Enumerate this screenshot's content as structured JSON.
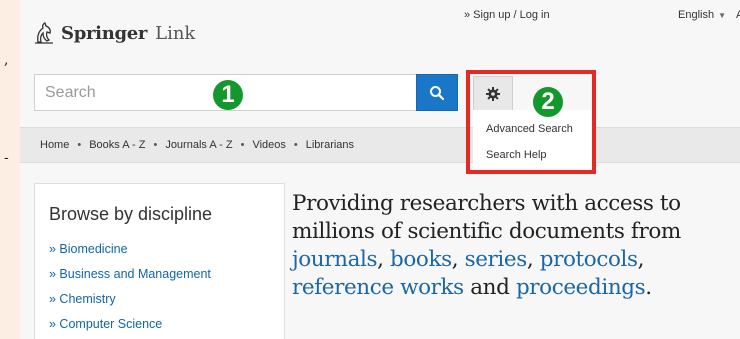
{
  "edge_marks": [
    ",",
    "-"
  ],
  "header": {
    "logo_primary": "Springer",
    "logo_secondary": "Link",
    "signup_label": "» Sign up / Log in",
    "language_label": "English",
    "language_extra": "A"
  },
  "search": {
    "placeholder": "Search",
    "search_icon": "magnifier-icon",
    "settings_icon": "gear-icon"
  },
  "nav": {
    "items": [
      "Home",
      "Books A - Z",
      "Journals A - Z",
      "Videos",
      "Librarians"
    ],
    "separator": "•"
  },
  "search_menu": {
    "items": [
      "Advanced Search",
      "Search Help"
    ]
  },
  "badges": [
    "1",
    "2"
  ],
  "browse": {
    "title": "Browse by discipline",
    "items": [
      "» Biomedicine",
      "» Business and Management",
      "» Chemistry",
      "» Computer Science"
    ]
  },
  "tagline": {
    "line1": "Providing researchers with access to",
    "line2": "millions of scientific documents from",
    "links": [
      "journals",
      "books",
      "series",
      "protocols",
      "reference works",
      "proceedings"
    ],
    "and_word": "and",
    "comma": ",",
    "period": "."
  },
  "colors": {
    "accent_blue": "#1a77c8",
    "highlight_red": "#e42a23",
    "badge_green": "#14972d",
    "link_blue": "#1a67a8"
  }
}
